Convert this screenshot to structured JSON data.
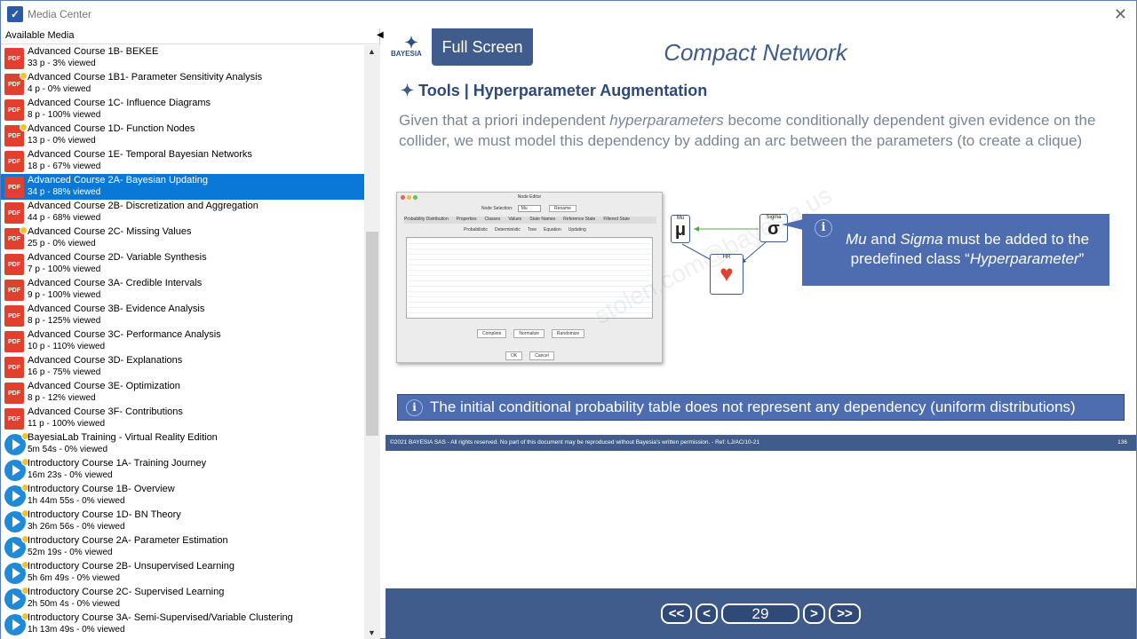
{
  "window": {
    "title": "Media Center",
    "icon": "app-icon"
  },
  "left_panel": {
    "header": "Available Media",
    "items": [
      {
        "name": "Advanced Course 1B- BEKEE",
        "meta": "33 p - 3% viewed",
        "type": "pdf",
        "badge": false
      },
      {
        "name": "Advanced Course 1B1- Parameter Sensitivity Analysis",
        "meta": "4 p - 0% viewed",
        "type": "pdf",
        "badge": true
      },
      {
        "name": "Advanced Course 1C- Influence Diagrams",
        "meta": "8 p - 100% viewed",
        "type": "pdf",
        "badge": false
      },
      {
        "name": "Advanced Course 1D- Function Nodes",
        "meta": "13 p - 0% viewed",
        "type": "pdf",
        "badge": true
      },
      {
        "name": "Advanced Course 1E- Temporal Bayesian Networks",
        "meta": "18 p - 67% viewed",
        "type": "pdf",
        "badge": false
      },
      {
        "name": "Advanced Course 2A- Bayesian Updating",
        "meta": "34 p - 88% viewed",
        "type": "pdf",
        "badge": false,
        "selected": true
      },
      {
        "name": "Advanced Course 2B- Discretization and Aggregation",
        "meta": "44 p - 68% viewed",
        "type": "pdf",
        "badge": false
      },
      {
        "name": "Advanced Course 2C- Missing Values",
        "meta": "25 p - 0% viewed",
        "type": "pdf",
        "badge": true
      },
      {
        "name": "Advanced Course 2D- Variable Synthesis",
        "meta": "7 p - 100% viewed",
        "type": "pdf",
        "badge": false
      },
      {
        "name": "Advanced Course 3A- Credible Intervals",
        "meta": "9 p - 100% viewed",
        "type": "pdf",
        "badge": false
      },
      {
        "name": "Advanced Course 3B- Evidence Analysis",
        "meta": "8 p - 125% viewed",
        "type": "pdf",
        "badge": false
      },
      {
        "name": "Advanced Course 3C- Performance Analysis",
        "meta": "10 p - 110% viewed",
        "type": "pdf",
        "badge": false
      },
      {
        "name": "Advanced Course 3D- Explanations",
        "meta": "16 p - 75% viewed",
        "type": "pdf",
        "badge": false
      },
      {
        "name": "Advanced Course 3E- Optimization",
        "meta": "8 p - 12% viewed",
        "type": "pdf",
        "badge": false
      },
      {
        "name": "Advanced Course 3F- Contributions",
        "meta": "11 p - 100% viewed",
        "type": "pdf",
        "badge": false
      },
      {
        "name": "BayesiaLab Training - Virtual Reality Edition",
        "meta": "5m 54s - 0% viewed",
        "type": "video",
        "badge": true
      },
      {
        "name": "Introductory Course 1A- Training Journey",
        "meta": "16m 23s - 0% viewed",
        "type": "video",
        "badge": true
      },
      {
        "name": "Introductory Course 1B- Overview",
        "meta": "1h 44m 55s - 0% viewed",
        "type": "video",
        "badge": true
      },
      {
        "name": "Introductory Course 1D- BN Theory",
        "meta": "3h 26m 56s - 0% viewed",
        "type": "video",
        "badge": true
      },
      {
        "name": "Introductory Course 2A- Parameter Estimation",
        "meta": "52m 19s - 0% viewed",
        "type": "video",
        "badge": true
      },
      {
        "name": "Introductory Course 2B- Unsupervised Learning",
        "meta": "5h 6m 49s - 0% viewed",
        "type": "video",
        "badge": true
      },
      {
        "name": "Introductory Course 2C- Supervised Learning",
        "meta": "2h 50m 4s - 0% viewed",
        "type": "video",
        "badge": true
      },
      {
        "name": "Introductory Course 3A- Semi-Supervised/Variable Clustering",
        "meta": "1h 13m 49s - 0% viewed",
        "type": "video",
        "badge": true
      }
    ]
  },
  "slide": {
    "fullscreen_label": "Full Screen",
    "logo_text": "BAYESIA",
    "title": "Compact Network",
    "section": "Tools | Hyperparameter Augmentation",
    "paragraph_html": "Given that a priori independent <i>hyperparameters</i> become conditionally dependent given evidence on the collider, we must model this dependency by adding an arc between the parameters (to create a clique)",
    "node_editor": {
      "title": "Node Editor",
      "node_selection_label": "Node Selection:",
      "node_selection_value": "Mu",
      "rename": "Rename",
      "tabs": [
        "Probability Distribution",
        "Properties",
        "Classes",
        "Values",
        "State Names",
        "Reference State",
        "Filtered State"
      ],
      "subtabs": [
        "Probabilistic",
        "Deterministic",
        "Tree",
        "Equation",
        "Updating"
      ],
      "buttons": [
        "Complete",
        "Normalize",
        "Randomize"
      ],
      "ok": "OK",
      "cancel": "Cancel"
    },
    "nodes": {
      "mu_label": "Mu",
      "mu_glyph": "μ",
      "sigma_label": "Sigma",
      "sigma_glyph": "σ",
      "hr_label": "HR"
    },
    "callout_html": "<i>Mu</i> and <i>Sigma</i> must be added to the predefined class “<i>Hyperparameter</i>”",
    "info_text": "The initial conditional probability table does not represent any dependency (uniform distributions)",
    "watermark": "stolen.com@bayesia.us",
    "footer": "©2021 BAYESIA SAS - All rights reserved. No part of this document may be reproduced without Bayesia's written permission. - Ref: LJ/AC/10-21",
    "page_number": "136"
  },
  "nav": {
    "first": "<<",
    "prev": "<",
    "page": "29",
    "next": ">",
    "last": ">>"
  },
  "colors": {
    "accent": "#3f5c8c",
    "selection": "#0a78d7",
    "pdf": "#e0412f",
    "video": "#1f8ad8",
    "callout": "#4d6db0"
  }
}
